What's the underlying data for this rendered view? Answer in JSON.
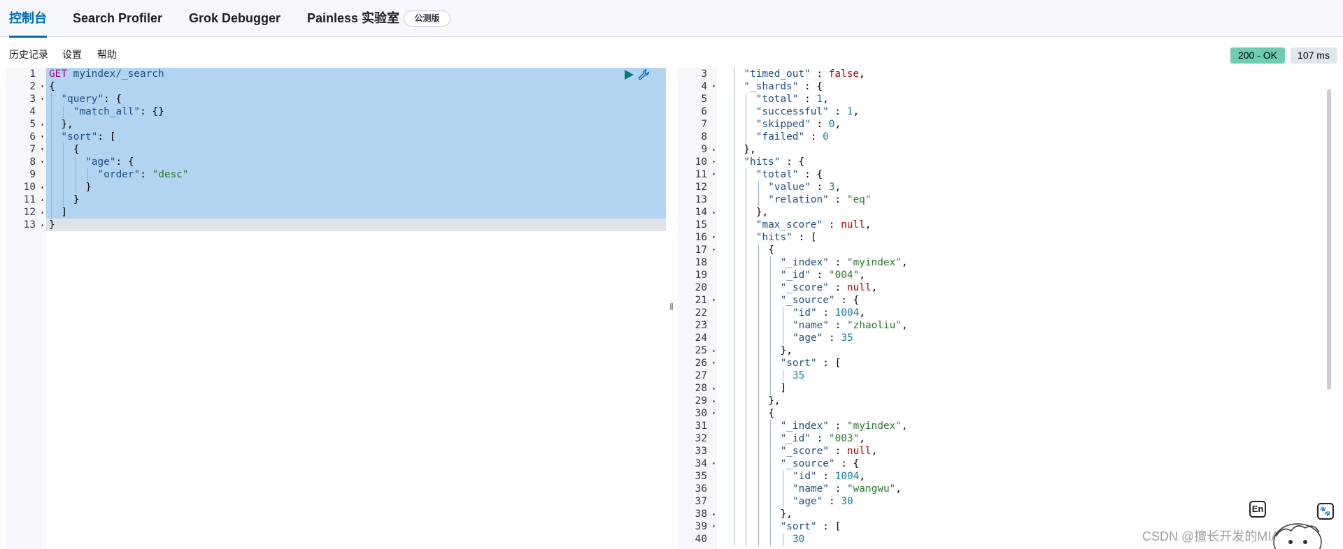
{
  "tabs": [
    {
      "label": "控制台",
      "active": true
    },
    {
      "label": "Search Profiler",
      "active": false
    },
    {
      "label": "Grok Debugger",
      "active": false
    },
    {
      "label": "Painless 实验室",
      "active": false
    }
  ],
  "beta_badge": "公测版",
  "toolbar": {
    "history": "历史记录",
    "settings": "设置",
    "help": "帮助",
    "status": "200 - OK",
    "time": "107 ms"
  },
  "request": {
    "method": "GET",
    "url": "myindex/_search",
    "lines": [
      {
        "n": "1",
        "fold": "",
        "indent": 0,
        "segs": [
          [
            "method",
            "GET"
          ],
          [
            "plain",
            " "
          ],
          [
            "url",
            "myindex/_search"
          ]
        ]
      },
      {
        "n": "2",
        "fold": "▾",
        "indent": 0,
        "segs": [
          [
            "plain",
            "{"
          ]
        ]
      },
      {
        "n": "3",
        "fold": "▾",
        "indent": 1,
        "segs": [
          [
            "key",
            "\"query\""
          ],
          [
            "plain",
            ": {"
          ]
        ]
      },
      {
        "n": "4",
        "fold": "",
        "indent": 2,
        "segs": [
          [
            "key",
            "\"match_all\""
          ],
          [
            "plain",
            ": {}"
          ]
        ]
      },
      {
        "n": "5",
        "fold": "▴",
        "indent": 1,
        "segs": [
          [
            "plain",
            "},"
          ]
        ]
      },
      {
        "n": "6",
        "fold": "▾",
        "indent": 1,
        "segs": [
          [
            "key",
            "\"sort\""
          ],
          [
            "plain",
            ": ["
          ]
        ]
      },
      {
        "n": "7",
        "fold": "▾",
        "indent": 2,
        "segs": [
          [
            "plain",
            "{"
          ]
        ]
      },
      {
        "n": "8",
        "fold": "▾",
        "indent": 3,
        "segs": [
          [
            "key",
            "\"age\""
          ],
          [
            "plain",
            ": {"
          ]
        ]
      },
      {
        "n": "9",
        "fold": "",
        "indent": 4,
        "segs": [
          [
            "key",
            "\"order\""
          ],
          [
            "plain",
            ": "
          ],
          [
            "str",
            "\"desc\""
          ]
        ]
      },
      {
        "n": "10",
        "fold": "▴",
        "indent": 3,
        "segs": [
          [
            "plain",
            "}"
          ]
        ]
      },
      {
        "n": "11",
        "fold": "▴",
        "indent": 2,
        "segs": [
          [
            "plain",
            "}"
          ]
        ]
      },
      {
        "n": "12",
        "fold": "▴",
        "indent": 1,
        "segs": [
          [
            "plain",
            "]"
          ]
        ]
      },
      {
        "n": "13",
        "fold": "▴",
        "indent": 0,
        "segs": [
          [
            "plain",
            "}"
          ]
        ]
      }
    ]
  },
  "response": {
    "lines": [
      {
        "n": "3",
        "fold": "",
        "indent": 1,
        "segs": [
          [
            "key",
            "\"timed_out\""
          ],
          [
            "plain",
            " : "
          ],
          [
            "bool",
            "false"
          ],
          [
            "plain",
            ","
          ]
        ]
      },
      {
        "n": "4",
        "fold": "▾",
        "indent": 1,
        "segs": [
          [
            "key",
            "\"_shards\""
          ],
          [
            "plain",
            " : {"
          ]
        ]
      },
      {
        "n": "5",
        "fold": "",
        "indent": 2,
        "segs": [
          [
            "key",
            "\"total\""
          ],
          [
            "plain",
            " : "
          ],
          [
            "num",
            "1"
          ],
          [
            "plain",
            ","
          ]
        ]
      },
      {
        "n": "6",
        "fold": "",
        "indent": 2,
        "segs": [
          [
            "key",
            "\"successful\""
          ],
          [
            "plain",
            " : "
          ],
          [
            "num",
            "1"
          ],
          [
            "plain",
            ","
          ]
        ]
      },
      {
        "n": "7",
        "fold": "",
        "indent": 2,
        "segs": [
          [
            "key",
            "\"skipped\""
          ],
          [
            "plain",
            " : "
          ],
          [
            "num",
            "0"
          ],
          [
            "plain",
            ","
          ]
        ]
      },
      {
        "n": "8",
        "fold": "",
        "indent": 2,
        "segs": [
          [
            "key",
            "\"failed\""
          ],
          [
            "plain",
            " : "
          ],
          [
            "num",
            "0"
          ]
        ]
      },
      {
        "n": "9",
        "fold": "▴",
        "indent": 1,
        "segs": [
          [
            "plain",
            "},"
          ]
        ]
      },
      {
        "n": "10",
        "fold": "▾",
        "indent": 1,
        "segs": [
          [
            "key",
            "\"hits\""
          ],
          [
            "plain",
            " : {"
          ]
        ]
      },
      {
        "n": "11",
        "fold": "▾",
        "indent": 2,
        "segs": [
          [
            "key",
            "\"total\""
          ],
          [
            "plain",
            " : {"
          ]
        ]
      },
      {
        "n": "12",
        "fold": "",
        "indent": 3,
        "segs": [
          [
            "key",
            "\"value\""
          ],
          [
            "plain",
            " : "
          ],
          [
            "num",
            "3"
          ],
          [
            "plain",
            ","
          ]
        ]
      },
      {
        "n": "13",
        "fold": "",
        "indent": 3,
        "segs": [
          [
            "key",
            "\"relation\""
          ],
          [
            "plain",
            " : "
          ],
          [
            "str",
            "\"eq\""
          ]
        ]
      },
      {
        "n": "14",
        "fold": "▴",
        "indent": 2,
        "segs": [
          [
            "plain",
            "},"
          ]
        ]
      },
      {
        "n": "15",
        "fold": "",
        "indent": 2,
        "segs": [
          [
            "key",
            "\"max_score\""
          ],
          [
            "plain",
            " : "
          ],
          [
            "bool",
            "null"
          ],
          [
            "plain",
            ","
          ]
        ]
      },
      {
        "n": "16",
        "fold": "▾",
        "indent": 2,
        "segs": [
          [
            "key",
            "\"hits\""
          ],
          [
            "plain",
            " : ["
          ]
        ]
      },
      {
        "n": "17",
        "fold": "▾",
        "indent": 3,
        "segs": [
          [
            "plain",
            "{"
          ]
        ]
      },
      {
        "n": "18",
        "fold": "",
        "indent": 4,
        "segs": [
          [
            "key",
            "\"_index\""
          ],
          [
            "plain",
            " : "
          ],
          [
            "str",
            "\"myindex\""
          ],
          [
            "plain",
            ","
          ]
        ]
      },
      {
        "n": "19",
        "fold": "",
        "indent": 4,
        "segs": [
          [
            "key",
            "\"_id\""
          ],
          [
            "plain",
            " : "
          ],
          [
            "str",
            "\"004\""
          ],
          [
            "plain",
            ","
          ]
        ]
      },
      {
        "n": "20",
        "fold": "",
        "indent": 4,
        "segs": [
          [
            "key",
            "\"_score\""
          ],
          [
            "plain",
            " : "
          ],
          [
            "bool",
            "null"
          ],
          [
            "plain",
            ","
          ]
        ]
      },
      {
        "n": "21",
        "fold": "▾",
        "indent": 4,
        "segs": [
          [
            "key",
            "\"_source\""
          ],
          [
            "plain",
            " : {"
          ]
        ]
      },
      {
        "n": "22",
        "fold": "",
        "indent": 5,
        "segs": [
          [
            "key",
            "\"id\""
          ],
          [
            "plain",
            " : "
          ],
          [
            "num",
            "1004"
          ],
          [
            "plain",
            ","
          ]
        ]
      },
      {
        "n": "23",
        "fold": "",
        "indent": 5,
        "segs": [
          [
            "key",
            "\"name\""
          ],
          [
            "plain",
            " : "
          ],
          [
            "str",
            "\"zhaoliu\""
          ],
          [
            "plain",
            ","
          ]
        ]
      },
      {
        "n": "24",
        "fold": "",
        "indent": 5,
        "segs": [
          [
            "key",
            "\"age\""
          ],
          [
            "plain",
            " : "
          ],
          [
            "num",
            "35"
          ]
        ]
      },
      {
        "n": "25",
        "fold": "▴",
        "indent": 4,
        "segs": [
          [
            "plain",
            "},"
          ]
        ]
      },
      {
        "n": "26",
        "fold": "▾",
        "indent": 4,
        "segs": [
          [
            "key",
            "\"sort\""
          ],
          [
            "plain",
            " : ["
          ]
        ]
      },
      {
        "n": "27",
        "fold": "",
        "indent": 5,
        "segs": [
          [
            "num",
            "35"
          ]
        ]
      },
      {
        "n": "28",
        "fold": "▴",
        "indent": 4,
        "segs": [
          [
            "plain",
            "]"
          ]
        ]
      },
      {
        "n": "29",
        "fold": "▴",
        "indent": 3,
        "segs": [
          [
            "plain",
            "},"
          ]
        ]
      },
      {
        "n": "30",
        "fold": "▾",
        "indent": 3,
        "segs": [
          [
            "plain",
            "{"
          ]
        ]
      },
      {
        "n": "31",
        "fold": "",
        "indent": 4,
        "segs": [
          [
            "key",
            "\"_index\""
          ],
          [
            "plain",
            " : "
          ],
          [
            "str",
            "\"myindex\""
          ],
          [
            "plain",
            ","
          ]
        ]
      },
      {
        "n": "32",
        "fold": "",
        "indent": 4,
        "segs": [
          [
            "key",
            "\"_id\""
          ],
          [
            "plain",
            " : "
          ],
          [
            "str",
            "\"003\""
          ],
          [
            "plain",
            ","
          ]
        ]
      },
      {
        "n": "33",
        "fold": "",
        "indent": 4,
        "segs": [
          [
            "key",
            "\"_score\""
          ],
          [
            "plain",
            " : "
          ],
          [
            "bool",
            "null"
          ],
          [
            "plain",
            ","
          ]
        ]
      },
      {
        "n": "34",
        "fold": "▾",
        "indent": 4,
        "segs": [
          [
            "key",
            "\"_source\""
          ],
          [
            "plain",
            " : {"
          ]
        ]
      },
      {
        "n": "35",
        "fold": "",
        "indent": 5,
        "segs": [
          [
            "key",
            "\"id\""
          ],
          [
            "plain",
            " : "
          ],
          [
            "num",
            "1004"
          ],
          [
            "plain",
            ","
          ]
        ]
      },
      {
        "n": "36",
        "fold": "",
        "indent": 5,
        "segs": [
          [
            "key",
            "\"name\""
          ],
          [
            "plain",
            " : "
          ],
          [
            "str",
            "\"wangwu\""
          ],
          [
            "plain",
            ","
          ]
        ]
      },
      {
        "n": "37",
        "fold": "",
        "indent": 5,
        "segs": [
          [
            "key",
            "\"age\""
          ],
          [
            "plain",
            " : "
          ],
          [
            "num",
            "30"
          ]
        ]
      },
      {
        "n": "38",
        "fold": "▴",
        "indent": 4,
        "segs": [
          [
            "plain",
            "},"
          ]
        ]
      },
      {
        "n": "39",
        "fold": "▾",
        "indent": 4,
        "segs": [
          [
            "key",
            "\"sort\""
          ],
          [
            "plain",
            " : ["
          ]
        ]
      },
      {
        "n": "40",
        "fold": "",
        "indent": 5,
        "segs": [
          [
            "num",
            "30"
          ]
        ]
      }
    ]
  },
  "overlay": {
    "watermark": "CSDN @擅长开发的MIAO",
    "widget_lang": "En",
    "widget_paw": "🐾"
  },
  "colors": {
    "accent": "#006bb8",
    "status_ok": "#6dccb1",
    "selection": "#b3d4f0"
  }
}
